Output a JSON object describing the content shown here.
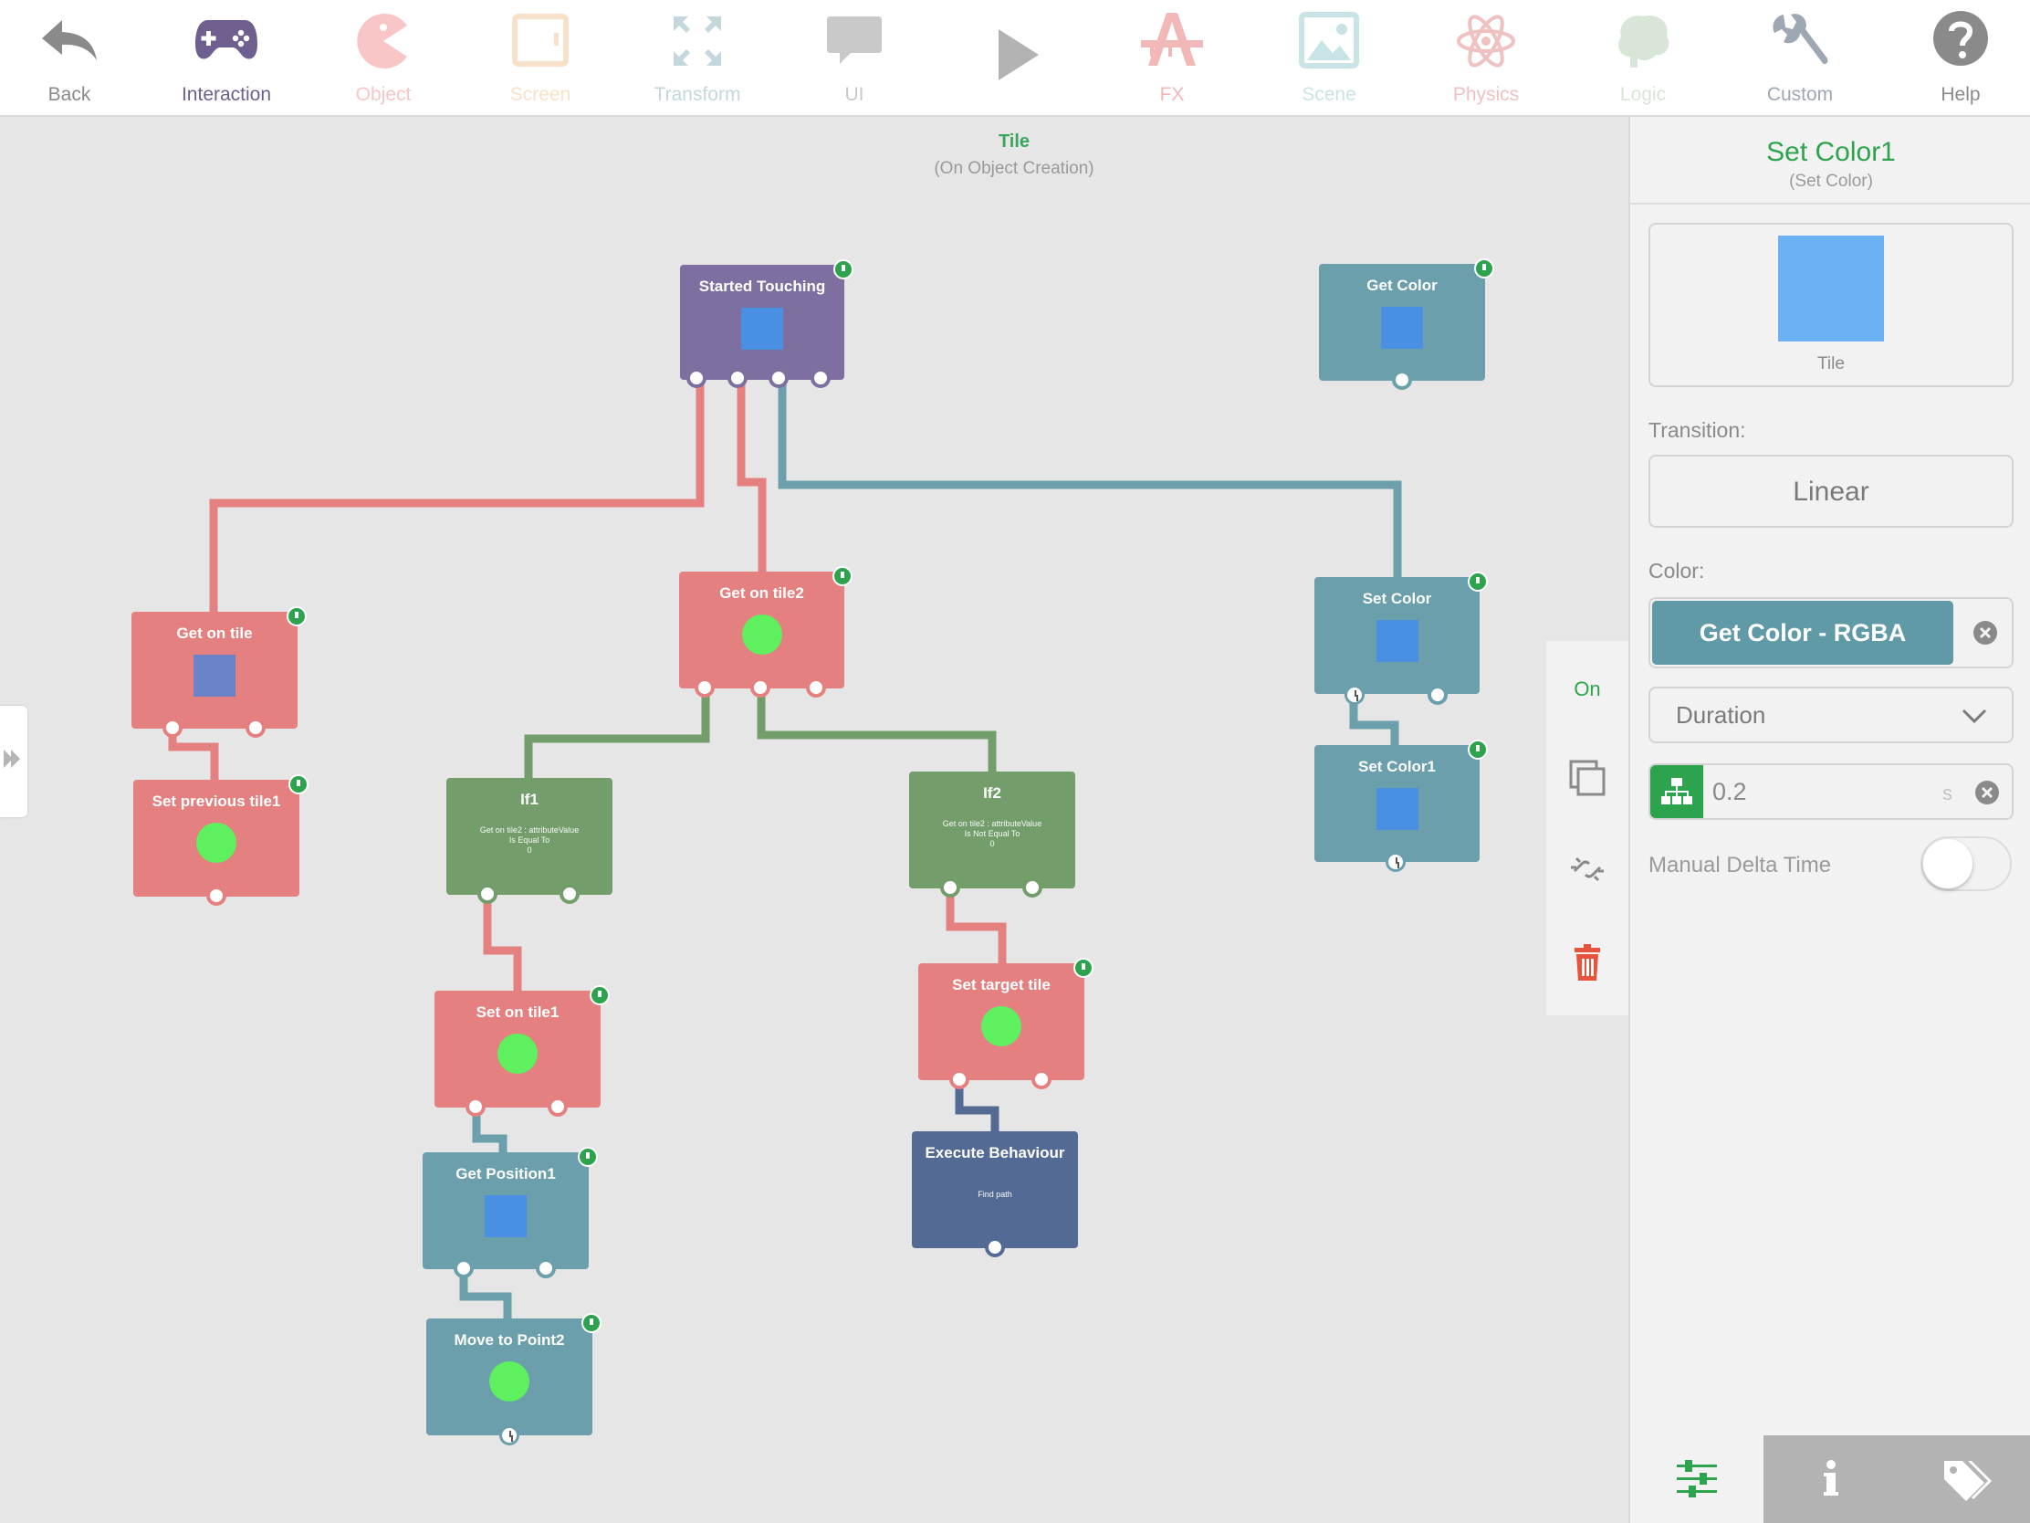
{
  "toolbar": {
    "items": [
      {
        "label": "Back",
        "color": "#8a8a8a"
      },
      {
        "label": "Interaction",
        "color": "#6e5f8e"
      },
      {
        "label": "Object",
        "color": "#f8c6c6"
      },
      {
        "label": "Screen",
        "color": "#f7e2c9"
      },
      {
        "label": "Transform",
        "color": "#c3d7dc"
      },
      {
        "label": "UI",
        "color": "#c9c9c9"
      },
      {
        "label": "FX",
        "color": "#f2b7b7"
      },
      {
        "label": "Scene",
        "color": "#c9e4e6"
      },
      {
        "label": "Physics",
        "color": "#f0c1c1"
      },
      {
        "label": "Logic",
        "color": "#d7e6d7"
      },
      {
        "label": "Custom",
        "color": "#9ea8b3"
      },
      {
        "label": "Help",
        "color": "#8a8a8a"
      }
    ]
  },
  "canvas": {
    "title": "Tile",
    "subtitle": "(On Object Creation)"
  },
  "nodes": {
    "started_touching": {
      "title": "Started Touching"
    },
    "get_color": {
      "title": "Get Color"
    },
    "get_on_tile2": {
      "title": "Get on tile2"
    },
    "set_color": {
      "title": "Set Color"
    },
    "set_color1": {
      "title": "Set Color1"
    },
    "get_on_tile": {
      "title": "Get on tile"
    },
    "set_previous_tile1": {
      "title": "Set previous tile1"
    },
    "if1": {
      "title": "If1",
      "condition": "Get on tile2 : attributeValue\nIs Equal To\n0"
    },
    "if2": {
      "title": "If2",
      "condition": "Get on tile2 : attributeValue\nIs Not Equal To\n0"
    },
    "set_on_tile1": {
      "title": "Set on tile1"
    },
    "set_target_tile": {
      "title": "Set target tile"
    },
    "get_position1": {
      "title": "Get Position1"
    },
    "execute_behaviour": {
      "title": "Execute Behaviour",
      "detail": "Find path"
    },
    "move_to_point2": {
      "title": "Move to Point2"
    }
  },
  "actions": {
    "on_label": "On",
    "copy_icon": "copy-icon",
    "unlink_icon": "unlink-icon",
    "delete_icon": "trash-icon"
  },
  "inspector": {
    "title": "Set Color1",
    "subtitle": "(Set Color)",
    "object_label": "Tile",
    "transition_label": "Transition:",
    "transition_value": "Linear",
    "color_label": "Color:",
    "color_value": "Get Color - RGBA",
    "duration_select": "Duration",
    "duration_value": "0.2",
    "duration_unit": "s",
    "manual_delta_label": "Manual Delta Time",
    "manual_delta_on": false,
    "tabs": [
      "settings-sliders-icon",
      "info-icon",
      "tags-icon"
    ]
  },
  "colors": {
    "accent_green": "#2ea34e",
    "node_red": "#e4807f",
    "node_teal": "#6a9fab",
    "node_green": "#739d6b",
    "node_purple": "#7d6fa0",
    "node_navy": "#536b94"
  }
}
